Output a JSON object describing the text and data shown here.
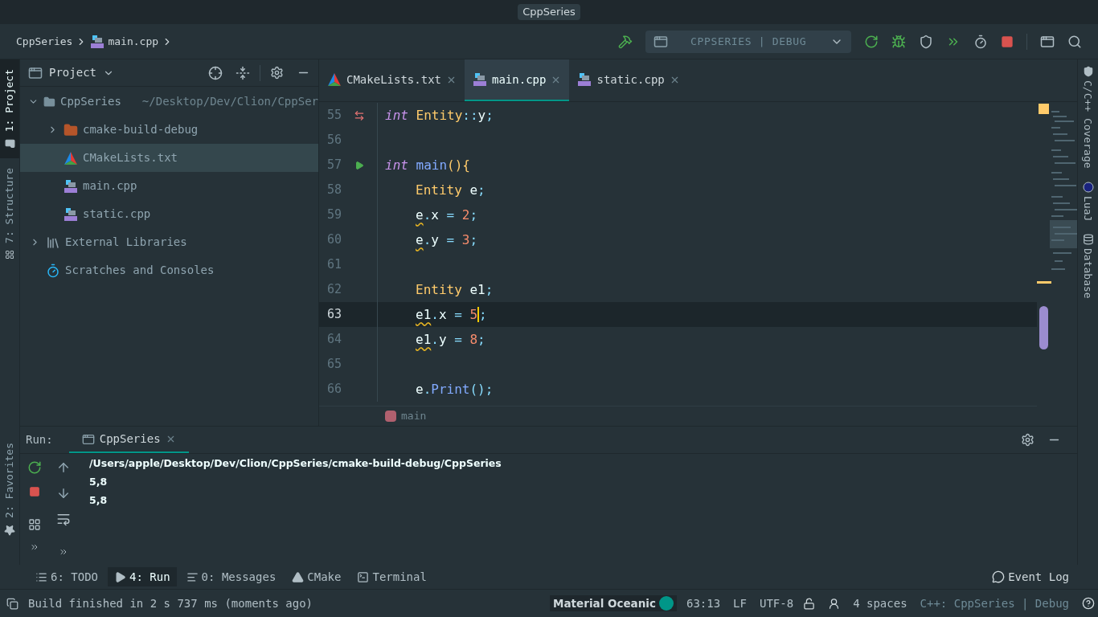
{
  "title_bar": {
    "title": "CppSeries"
  },
  "breadcrumb": [
    {
      "label": "CppSeries",
      "kind": "text"
    },
    {
      "label": "main.cpp",
      "kind": "cpp"
    }
  ],
  "run_config": {
    "label": "CPPSERIES | DEBUG"
  },
  "left_stripe": [
    {
      "label": "1: Project",
      "selected": true
    },
    {
      "label": "7: Structure",
      "selected": false
    }
  ],
  "left_stripe_bottom": [
    {
      "label": "2: Favorites",
      "selected": false
    }
  ],
  "project_panel": {
    "title": "Project",
    "tree": [
      {
        "label": "CppSeries",
        "path": "~/Desktop/Dev/Clion/CppSer",
        "kind": "folder",
        "expanded": true,
        "selected": false,
        "children": [
          {
            "label": "cmake-build-debug",
            "kind": "build_folder",
            "expanded": false,
            "selected": false
          },
          {
            "label": "CMakeLists.txt",
            "kind": "cmake",
            "selected": true
          },
          {
            "label": "main.cpp",
            "kind": "cpp",
            "selected": false
          },
          {
            "label": "static.cpp",
            "kind": "cpp",
            "selected": false
          }
        ]
      },
      {
        "label": "External Libraries",
        "kind": "library",
        "expanded": false,
        "selected": false
      },
      {
        "label": "Scratches and Consoles",
        "kind": "scratch",
        "selected": false
      }
    ]
  },
  "editor_tabs": [
    {
      "label": "CMakeLists.txt",
      "kind": "cmake",
      "selected": false
    },
    {
      "label": "main.cpp",
      "kind": "cpp",
      "selected": true
    },
    {
      "label": "static.cpp",
      "kind": "cpp",
      "selected": false
    }
  ],
  "code": [
    {
      "number": "55",
      "kind": "override",
      "current": false,
      "indented": false,
      "tokens": [
        {
          "text": "int ",
          "kind": "keyword"
        },
        {
          "text": "Entity",
          "kind": "type"
        },
        {
          "text": "::",
          "kind": "punct"
        },
        {
          "text": "y",
          "kind": "ident"
        },
        {
          "text": ";",
          "kind": "punct"
        }
      ]
    },
    {
      "number": "56",
      "kind": "plain",
      "current": false
    },
    {
      "number": "57",
      "kind": "run",
      "current": false,
      "indented": false,
      "tokens": [
        {
          "text": "int ",
          "kind": "keyword"
        },
        {
          "text": "main",
          "kind": "func"
        },
        {
          "text": "(){",
          "kind": "brace"
        }
      ]
    },
    {
      "number": "58",
      "kind": "plain",
      "current": false,
      "indented": true,
      "tokens": [
        {
          "text": "Entity",
          "kind": "type"
        },
        {
          "text": " e",
          "kind": "ident"
        },
        {
          "text": ";",
          "kind": "punct"
        }
      ]
    },
    {
      "number": "59",
      "kind": "plain",
      "current": false,
      "indented": true,
      "tokens": [
        {
          "text": "e",
          "kind": "warn"
        },
        {
          "text": ".",
          "kind": "punct"
        },
        {
          "text": "x ",
          "kind": "ident"
        },
        {
          "text": "= ",
          "kind": "punct"
        },
        {
          "text": "2",
          "kind": "number"
        },
        {
          "text": ";",
          "kind": "punct"
        }
      ]
    },
    {
      "number": "60",
      "kind": "plain",
      "current": false,
      "indented": true,
      "tokens": [
        {
          "text": "e",
          "kind": "warn"
        },
        {
          "text": ".",
          "kind": "punct"
        },
        {
          "text": "y ",
          "kind": "ident"
        },
        {
          "text": "= ",
          "kind": "punct"
        },
        {
          "text": "3",
          "kind": "number"
        },
        {
          "text": ";",
          "kind": "punct"
        }
      ]
    },
    {
      "number": "61",
      "kind": "plain",
      "current": false
    },
    {
      "number": "62",
      "kind": "plain",
      "current": false,
      "indented": true,
      "tokens": [
        {
          "text": "Entity",
          "kind": "type"
        },
        {
          "text": " e1",
          "kind": "ident"
        },
        {
          "text": ";",
          "kind": "punct"
        }
      ]
    },
    {
      "number": "63",
      "kind": "plain",
      "current": true,
      "indented": true,
      "tokens": [
        {
          "text": "e1",
          "kind": "warn"
        },
        {
          "text": ".",
          "kind": "punct"
        },
        {
          "text": "x ",
          "kind": "ident"
        },
        {
          "text": "= ",
          "kind": "punct"
        },
        {
          "text": "5",
          "kind": "number",
          "caret": true
        },
        {
          "text": ";",
          "kind": "punct"
        }
      ]
    },
    {
      "number": "64",
      "kind": "plain",
      "current": false,
      "indented": true,
      "tokens": [
        {
          "text": "e1",
          "kind": "warn"
        },
        {
          "text": ".",
          "kind": "punct"
        },
        {
          "text": "y ",
          "kind": "ident"
        },
        {
          "text": "= ",
          "kind": "punct"
        },
        {
          "text": "8",
          "kind": "number"
        },
        {
          "text": ";",
          "kind": "punct"
        }
      ]
    },
    {
      "number": "65",
      "kind": "plain",
      "current": false
    },
    {
      "number": "66",
      "kind": "plain",
      "current": false,
      "indented": true,
      "tokens": [
        {
          "text": "e",
          "kind": "ident"
        },
        {
          "text": ".",
          "kind": "punct"
        },
        {
          "text": "Print",
          "kind": "func"
        },
        {
          "text": "();",
          "kind": "punct"
        }
      ]
    }
  ],
  "editor_breadcrumb": {
    "label": "main"
  },
  "right_stripe": [
    {
      "label": "C/C++ Coverage",
      "kind": "shield"
    },
    {
      "label": "LuaJ",
      "kind": "lua"
    },
    {
      "label": "Database",
      "kind": "database"
    }
  ],
  "run_panel": {
    "title": "Run:",
    "tabs": [
      {
        "label": "CppSeries",
        "selected": true
      }
    ],
    "output": [
      "/Users/apple/Desktop/Dev/Clion/CppSeries/cmake-build-debug/CppSeries",
      "5,8",
      "5,8"
    ]
  },
  "tool_windows": [
    {
      "label": "6: TODO",
      "kind": "todo",
      "selected": false
    },
    {
      "label": "4: Run",
      "kind": "run",
      "selected": true
    },
    {
      "label": "0: Messages",
      "kind": "messages",
      "selected": false
    },
    {
      "label": "CMake",
      "kind": "cmake",
      "selected": false
    },
    {
      "label": "Terminal",
      "kind": "terminal",
      "selected": false
    }
  ],
  "event_log": {
    "label": "Event Log"
  },
  "status_bar": {
    "message": "Build finished in 2 s 737 ms (moments ago)",
    "theme": "Material Oceanic",
    "position": "63:13",
    "line_separator": "LF",
    "encoding": "UTF-8",
    "indent": "4 spaces",
    "context": "C++: CppSeries | Debug"
  }
}
